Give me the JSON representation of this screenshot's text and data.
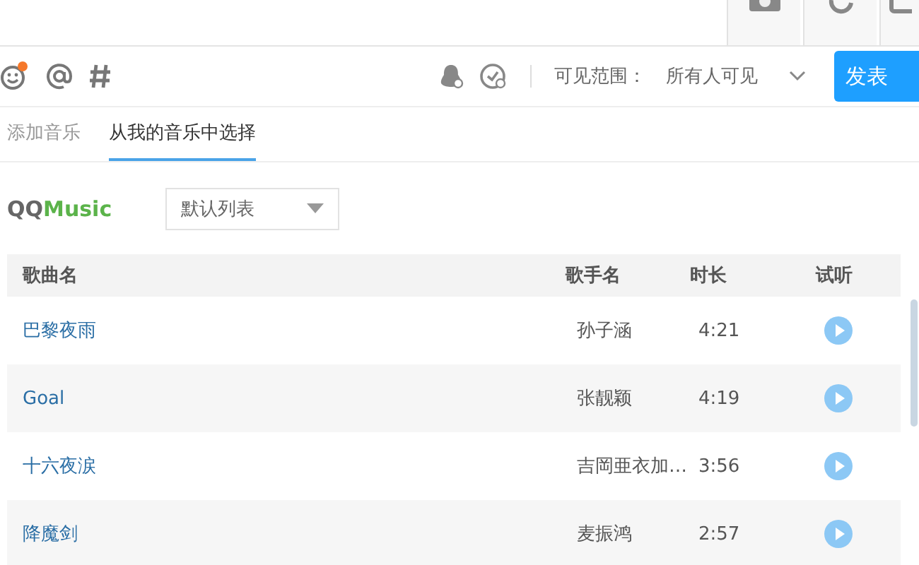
{
  "toolbar": {
    "visibility_label": "可见范围：",
    "visibility_value": "所有人可见",
    "publish_button": "发表"
  },
  "tabs": [
    {
      "label": "添加音乐",
      "selected": false
    },
    {
      "label": "从我的音乐中选择",
      "selected": true
    }
  ],
  "logo": {
    "part_1": "QQ",
    "part_2": "Music"
  },
  "playlist_dropdown": {
    "value": "默认列表"
  },
  "table": {
    "columns": [
      "歌曲名",
      "歌手名",
      "时长",
      "试听"
    ],
    "rows": [
      {
        "song": "巴黎夜雨",
        "singer": "孙子涵",
        "duration": "4:21"
      },
      {
        "song": "Goal",
        "singer": "张靓颖",
        "duration": "4:19"
      },
      {
        "song": "十六夜涙",
        "singer": "吉岡亜衣加…",
        "duration": "3:56"
      },
      {
        "song": "降魔剑",
        "singer": "麦振鸿",
        "duration": "2:57"
      }
    ]
  }
}
